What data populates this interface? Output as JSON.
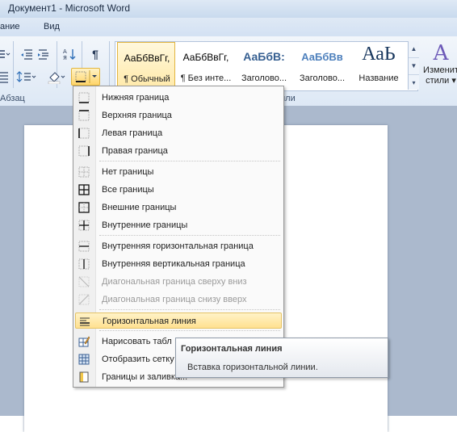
{
  "window": {
    "title": "Документ1  -  Microsoft Word"
  },
  "menu_row": {
    "left_fragment": "ание",
    "view_tab": "Вид"
  },
  "ribbon": {
    "paragraph_group_label": "Абзац",
    "styles_group_label_fragment": "или",
    "styles": [
      {
        "sample": "АаБбВвГг,",
        "name": "¶ Обычный",
        "selected": true
      },
      {
        "sample": "АаБбВвГг,",
        "name": "¶ Без инте..."
      },
      {
        "sample": "АаБбВ:",
        "name": "Заголово..."
      },
      {
        "sample": "АаБбВв",
        "name": "Заголово..."
      },
      {
        "sample": "АаЬ",
        "name": "Название"
      }
    ],
    "change_styles": {
      "icon": "A",
      "line1": "Изменит",
      "line2": "стили ▾"
    }
  },
  "border_menu": {
    "items": [
      {
        "label": "Нижняя граница",
        "icon": "bottom-border-icon"
      },
      {
        "label": "Верхняя граница",
        "icon": "top-border-icon"
      },
      {
        "label": "Левая граница",
        "icon": "left-border-icon"
      },
      {
        "label": "Правая граница",
        "icon": "right-border-icon"
      },
      {
        "label": "Нет границы",
        "icon": "no-border-icon"
      },
      {
        "label": "Все границы",
        "icon": "all-borders-icon"
      },
      {
        "label": "Внешние границы",
        "icon": "outside-borders-icon"
      },
      {
        "label": "Внутренние границы",
        "icon": "inside-borders-icon"
      },
      {
        "label": "Внутренняя горизонтальная граница",
        "icon": "inside-horizontal-border-icon"
      },
      {
        "label": "Внутренняя вертикальная граница",
        "icon": "inside-vertical-border-icon"
      },
      {
        "label": "Диагональная граница сверху вниз",
        "icon": "diagonal-down-border-icon",
        "disabled": true
      },
      {
        "label": "Диагональная граница снизу вверх",
        "icon": "diagonal-up-border-icon",
        "disabled": true
      },
      {
        "label": "Горизонтальная линия",
        "icon": "horizontal-line-icon",
        "highlighted": true
      },
      {
        "label": "Нарисовать табл",
        "icon": "draw-table-icon"
      },
      {
        "label": "Отобразить сетку",
        "icon": "view-gridlines-icon"
      },
      {
        "label": "Границы и заливка...",
        "icon": "borders-shading-icon"
      }
    ]
  },
  "tooltip": {
    "title": "Горизонтальная линия",
    "description": "Вставка горизонтальной линии."
  }
}
